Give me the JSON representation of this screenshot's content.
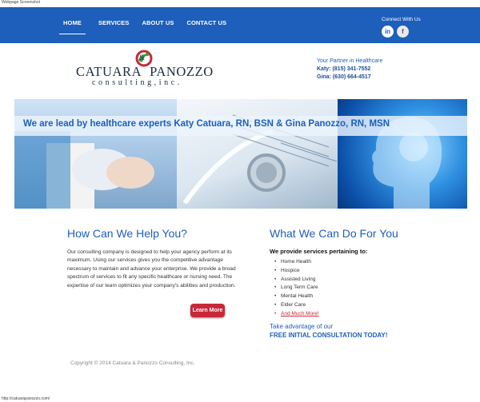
{
  "screenshot_label": "Webpage Screenshot",
  "nav": {
    "items": [
      {
        "label": "HOME",
        "active": true
      },
      {
        "label": "SERVICES",
        "active": false
      },
      {
        "label": "ABOUT US",
        "active": false
      },
      {
        "label": "CONTACT US",
        "active": false
      }
    ],
    "background_color": "#1d5fba"
  },
  "connect": {
    "label": "Connect With Us",
    "icons": [
      "linkedin-icon",
      "facebook-icon"
    ],
    "linkedin_glyph": "in",
    "facebook_glyph": "f"
  },
  "logo": {
    "name_left": "CATUARA",
    "amp": "&",
    "name_right": "PANOZZO",
    "subtitle": "consulting,inc."
  },
  "contact": {
    "tagline": "Your Partner in Healthcare",
    "katy": "Katy: (815) 341-7552",
    "gina": "Gina: (630) 664-4517"
  },
  "hero": {
    "banner_text": "We are lead by healthcare experts Katy Catuara, RN, BSN & Gina Panozzo, RN, MSN"
  },
  "left": {
    "heading": "How Can We Help You?",
    "body": "Our consulting company is designed to help your agency perform at its maximum.  Using our services gives you the competitive advantage necessary to maintain and advance your enterprise.  We provide a broad spectrum of services to fit any specific healthcare or nursing need. The expertise of our team optimizes your company's abilities and production.",
    "button": "Learn More"
  },
  "right": {
    "heading": "What We Can Do For You",
    "services_heading": "We provide services pertaining to:",
    "services": [
      "Home Health",
      "Hospice",
      "Assisted Living",
      "Long Term Care",
      "Mental Health",
      "Elder Care",
      "And Much More!"
    ],
    "take_advantage": "Take advantage of our",
    "free_consult": "FREE INITIAL CONSULTATION TODAY!"
  },
  "footer": {
    "copyright": "Copyright © 2014 Catuara & Panozzo Consulting, Inc."
  },
  "status_url": "http://catuarapanozzo.com/",
  "colors": {
    "accent_blue": "#1d5fba",
    "button_red": "#c8283a",
    "logo_navy": "#1c2c44"
  }
}
